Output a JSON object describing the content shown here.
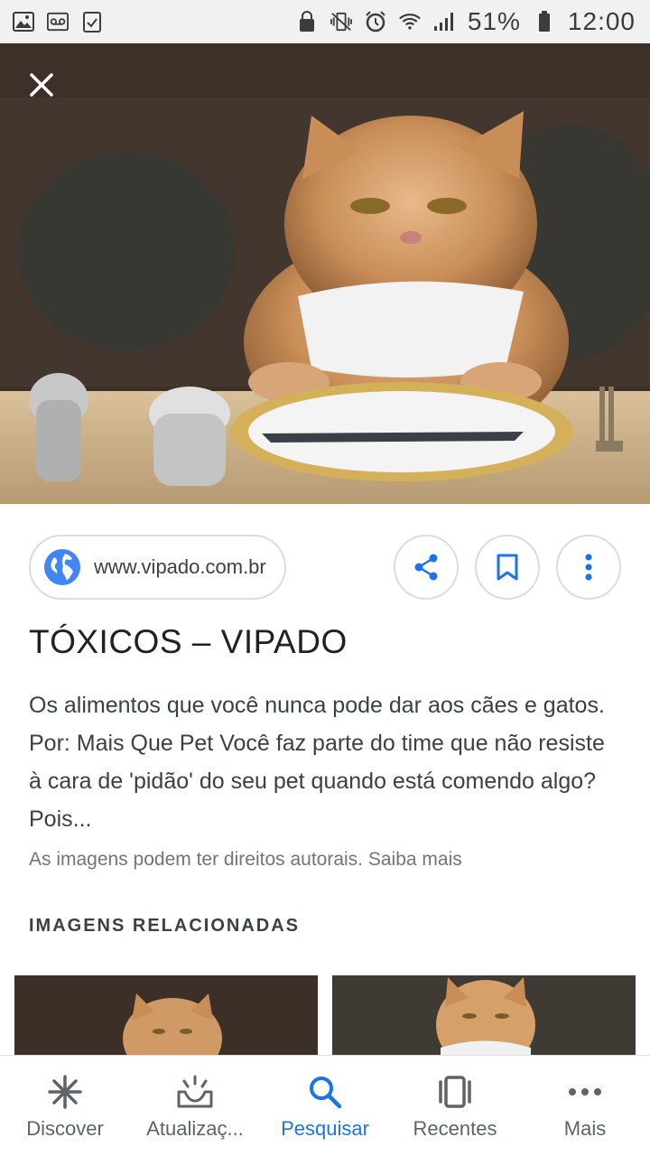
{
  "status_bar": {
    "battery_percent": "51%",
    "time": "12:00",
    "left_icons": [
      "image-icon",
      "voicemail-icon",
      "clipboard-check-icon"
    ],
    "right_icons": [
      "lock-icon",
      "vibrate-icon",
      "alarm-icon",
      "wifi-icon",
      "signal-icon",
      "battery-icon"
    ]
  },
  "image_viewer": {
    "close_icon": "close-icon",
    "source": {
      "domain": "www.vipado.com.br",
      "icon": "globe-icon"
    },
    "actions": {
      "share_icon": "share-icon",
      "save_icon": "bookmark-icon",
      "more_icon": "more-vert-icon"
    },
    "title": "TÓXICOS – VIPADO",
    "description": "Os alimentos que você nunca pode dar aos cães e gatos. Por: Mais Que Pet Você faz parte do time que não resiste à cara de 'pidão' do seu pet quando está comendo algo? Pois...",
    "copyright_note": "As imagens podem ter direitos autorais. Saiba mais",
    "related_heading": "IMAGENS RELACIONADAS"
  },
  "bottom_nav": {
    "items": [
      {
        "label": "Discover",
        "icon": "asterisk-icon",
        "active": false
      },
      {
        "label": "Atualizaç...",
        "icon": "updates-icon",
        "active": false
      },
      {
        "label": "Pesquisar",
        "icon": "search-icon",
        "active": true
      },
      {
        "label": "Recentes",
        "icon": "recents-icon",
        "active": false
      },
      {
        "label": "Mais",
        "icon": "more-horiz-icon",
        "active": false
      }
    ]
  },
  "colors": {
    "accent": "#1a73e8",
    "text_primary": "#202124",
    "text_secondary": "#3c4043",
    "text_muted": "#70757a",
    "border": "#dadce0"
  }
}
